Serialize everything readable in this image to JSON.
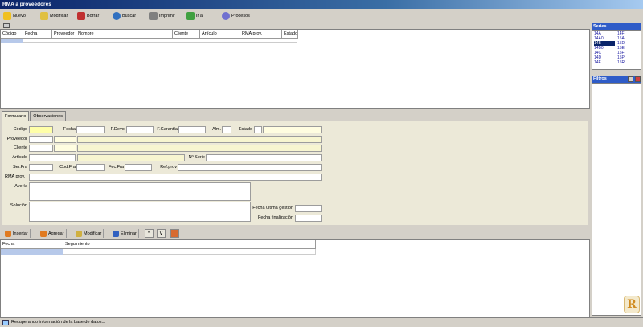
{
  "window": {
    "title": "RMA a proveedores"
  },
  "toolbar": [
    {
      "label": "Nuevo",
      "icon": "new-document-icon",
      "color": "#f0c020"
    },
    {
      "label": "Modificar",
      "icon": "edit-icon",
      "color": "#e0c040"
    },
    {
      "label": "Borrar",
      "icon": "delete-icon",
      "color": "#c03030"
    },
    {
      "label": "Buscar",
      "icon": "search-icon",
      "color": "#3070c0"
    },
    {
      "label": "Imprimir",
      "icon": "print-icon",
      "color": "#808080"
    },
    {
      "label": "Ir a",
      "icon": "goto-icon",
      "color": "#40a040"
    },
    {
      "label": "Procesos",
      "icon": "gear-icon",
      "color": "#7070d0"
    }
  ],
  "top_grid": {
    "columns": [
      "Código",
      "Fecha",
      "Proveedor",
      "Nombre",
      "Cliente",
      "Artículo",
      "RMA prov.",
      "Estado"
    ]
  },
  "tabs": [
    "Formulario",
    "Observaciones"
  ],
  "form": {
    "codigo": "Código",
    "fecha": "Fecha",
    "fdevol": "F.Devol",
    "fgarantia": "F.Garantía",
    "alm": "Alm.",
    "estado": "Estado",
    "proveedor": "Proveedor",
    "cliente": "Cliente",
    "articulo": "Artículo",
    "nserie": "Nº Serie",
    "serfra": "Ser.Fra",
    "codfra": "Cod.Fra",
    "fecfra": "Fec.Fra",
    "refprov": "Ref.prov",
    "rmaprov": "RMA prov.",
    "averia": "Avería",
    "solucion": "Solución",
    "fecha_ultima": "Fecha última gestión",
    "fecha_fin": "Fecha finalización"
  },
  "actions": [
    {
      "label": "Insertar",
      "icon": "insert-icon",
      "color": "#e07a20"
    },
    {
      "label": "Agregar",
      "icon": "add-icon",
      "color": "#e07a20"
    },
    {
      "label": "Modificar",
      "icon": "edit-icon",
      "color": "#d0b040"
    },
    {
      "label": "Eliminar",
      "icon": "delete-icon",
      "color": "#3060c0"
    }
  ],
  "bottom_grid": {
    "columns": [
      "Fecha",
      "Seguimiento"
    ]
  },
  "status": {
    "text": "Recuperando información de la base de datos..."
  },
  "series": {
    "title": "Series",
    "col1": [
      "14A",
      "14A0",
      "14B",
      "14B0",
      "14C",
      "14D",
      "14E"
    ],
    "col2": [
      "14F",
      "15A",
      "15D",
      "15E",
      "15F",
      "15P",
      "15R"
    ],
    "selected": "14B"
  },
  "filters": {
    "title": "Filtros"
  },
  "logo": {
    "letter": "R"
  }
}
